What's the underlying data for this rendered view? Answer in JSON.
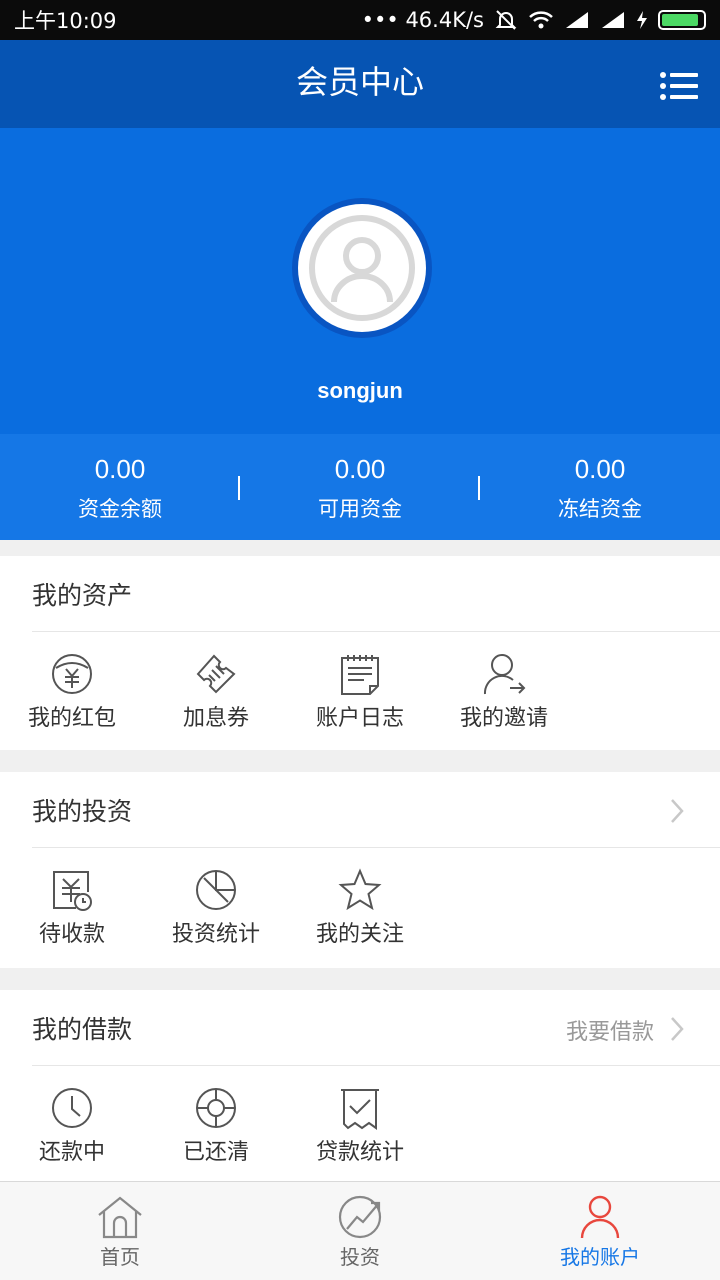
{
  "status_bar": {
    "time": "上午10:09",
    "network_speed": "••• 46.4K/s"
  },
  "nav": {
    "title": "会员中心",
    "menu_icon": "list-menu-icon"
  },
  "profile": {
    "username": "songjun"
  },
  "balances": [
    {
      "value": "0.00",
      "label": "资金余额"
    },
    {
      "value": "0.00",
      "label": "可用资金"
    },
    {
      "value": "0.00",
      "label": "冻结资金"
    }
  ],
  "assets": {
    "title": "我的资产",
    "items": [
      {
        "label": "我的红包",
        "icon": "red-envelope-icon"
      },
      {
        "label": "加息券",
        "icon": "coupon-icon"
      },
      {
        "label": "账户日志",
        "icon": "account-log-icon"
      },
      {
        "label": "我的邀请",
        "icon": "invite-user-icon"
      }
    ]
  },
  "investments": {
    "title": "我的投资",
    "items": [
      {
        "label": "待收款",
        "icon": "pending-receipt-icon"
      },
      {
        "label": "投资统计",
        "icon": "investment-stats-icon"
      },
      {
        "label": "我的关注",
        "icon": "star-icon"
      }
    ]
  },
  "loans": {
    "title": "我的借款",
    "link": "我要借款",
    "items": [
      {
        "label": "还款中",
        "icon": "clock-icon"
      },
      {
        "label": "已还清",
        "icon": "lifebuoy-icon"
      },
      {
        "label": "贷款统计",
        "icon": "loan-stats-icon"
      }
    ]
  },
  "tabs": [
    {
      "label": "首页",
      "icon": "home-icon"
    },
    {
      "label": "投资",
      "icon": "invest-trend-icon"
    },
    {
      "label": "我的账户",
      "icon": "user-icon",
      "active": true
    }
  ],
  "colors": {
    "nav": "#0654b3",
    "header": "#0a6ddf",
    "balances": "#1577e6",
    "active_tab": "#1677e6",
    "inactive_tab": "#666666",
    "icon_stroke": "#555555"
  }
}
